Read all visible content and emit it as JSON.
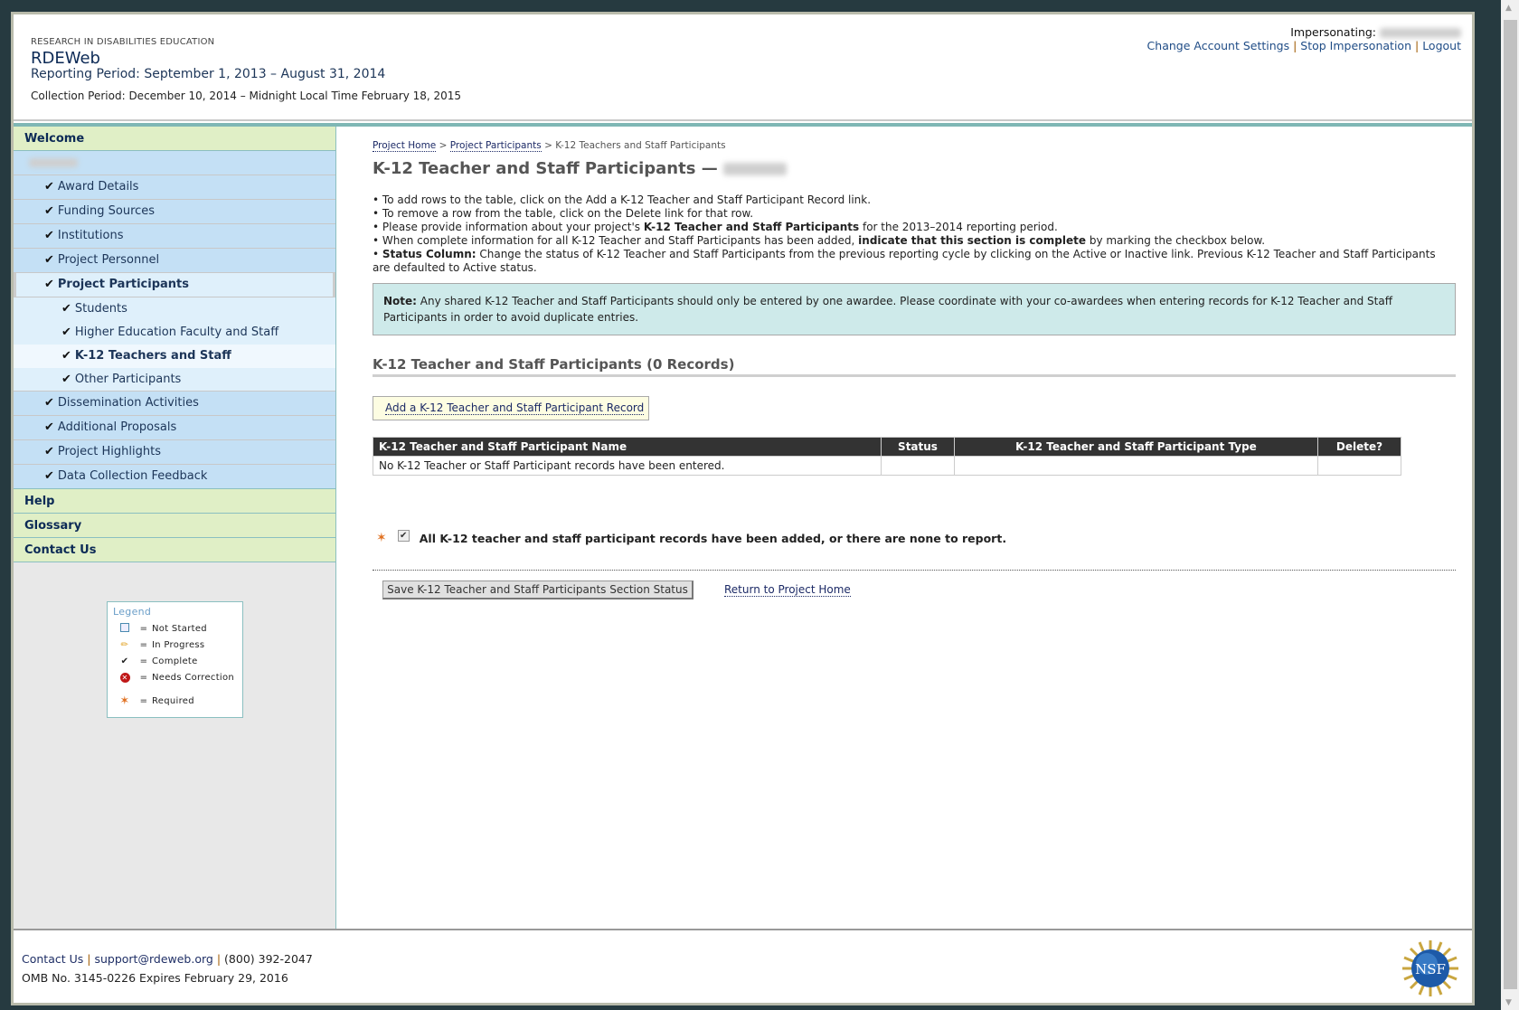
{
  "header": {
    "org": "RESEARCH IN DISABILITIES EDUCATION",
    "app_name": "RDEWeb",
    "reporting_period": "Reporting Period: September 1, 2013 – August 31, 2014",
    "collection_period": "Collection Period: December 10, 2014 – Midnight Local Time February 18, 2015",
    "impersonating_label": "Impersonating:",
    "links": {
      "change_account": "Change Account Settings",
      "stop_impersonation": "Stop Impersonation",
      "logout": "Logout"
    },
    "separator": "|"
  },
  "sidebar": {
    "welcome": "Welcome",
    "items": [
      {
        "label": "Award Details",
        "status": "complete"
      },
      {
        "label": "Funding Sources",
        "status": "complete"
      },
      {
        "label": "Institutions",
        "status": "complete"
      },
      {
        "label": "Project Personnel",
        "status": "complete"
      },
      {
        "label": "Project Participants",
        "status": "complete"
      },
      {
        "label": "Dissemination Activities",
        "status": "complete"
      },
      {
        "label": "Additional Proposals",
        "status": "complete"
      },
      {
        "label": "Project Highlights",
        "status": "complete"
      },
      {
        "label": "Data Collection Feedback",
        "status": "complete"
      }
    ],
    "sub_items": [
      {
        "label": "Students",
        "status": "complete"
      },
      {
        "label": "Higher Education Faculty and Staff",
        "status": "complete"
      },
      {
        "label": "K-12 Teachers and Staff",
        "status": "complete"
      },
      {
        "label": "Other Participants",
        "status": "complete"
      }
    ],
    "bottom": [
      "Help",
      "Glossary",
      "Contact Us"
    ],
    "check": "✔"
  },
  "legend": {
    "title": "Legend",
    "eq": "=",
    "items": [
      "Not Started",
      "In Progress",
      "Complete",
      "Needs Correction",
      "Required"
    ]
  },
  "main": {
    "breadcrumb": {
      "home": "Project Home",
      "sep": ">",
      "participants": "Project Participants",
      "current": "K-12 Teachers and Staff Participants"
    },
    "title": "K-12 Teacher and Staff Participants —",
    "bullets": {
      "b1": "To add rows to the table, click on the Add a K-12 Teacher and Staff Participant Record link.",
      "b2": "To remove a row from the table, click on the Delete link for that row.",
      "b3a": "Please provide information about your project's ",
      "b3b": "K-12 Teacher and Staff Participants",
      "b3c": " for the 2013–2014 reporting period.",
      "b4a": "When complete information for all K-12 Teacher and Staff Participants has been added, ",
      "b4b": "indicate that this section is complete",
      "b4c": " by marking the checkbox below.",
      "b5a": "Status Column:",
      "b5b": " Change the status of K-12 Teacher and Staff Participants from the previous reporting cycle by clicking on the Active or Inactive link. Previous K-12 Teacher and Staff Participants",
      "b5c": "are defaulted to Active status."
    },
    "note": {
      "label": "Note:",
      "text": " Any shared K-12 Teacher and Staff Participants should only be entered by one awardee. Please coordinate with your co-awardees when entering records for K-12 Teacher and Staff Participants in order to avoid duplicate entries."
    },
    "section_title": "K-12 Teacher and Staff Participants (0 Records)",
    "add_link": "Add a K-12 Teacher and Staff Participant Record",
    "table": {
      "columns": [
        "K-12 Teacher and Staff Participant Name",
        "Status",
        "K-12 Teacher and Staff Participant Type",
        "Delete?"
      ],
      "empty": "No K-12 Teacher or Staff Participant records have been entered."
    },
    "confirm_text": "All K-12 teacher and staff participant records have been added, or there are none to report.",
    "confirm_checked": true,
    "save_button": "Save K-12 Teacher and Staff Participants Section Status",
    "return_link": "Return to Project Home"
  },
  "footer": {
    "contact": "Contact Us",
    "sep": "|",
    "email": "support@rdeweb.org",
    "phone": "(800) 392-2047",
    "omb": "OMB No. 3145-0226 Expires February 29, 2016",
    "logo_text": "NSF"
  },
  "colors": {
    "background": "#263a40",
    "nav_green": "#e0efc6",
    "nav_blue": "#c4e0f5",
    "teal": "#7fb7b5",
    "required": "#e07020"
  }
}
